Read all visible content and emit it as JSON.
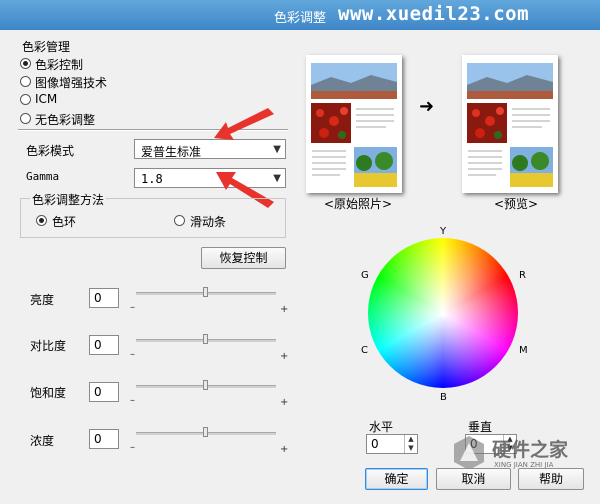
{
  "window": {
    "title": "色彩调整",
    "watermark": "www.xuedil23.com"
  },
  "color_mgmt": {
    "title": "色彩管理",
    "options": [
      {
        "label": "色彩控制",
        "selected": true
      },
      {
        "label": "图像增强技术",
        "selected": false
      },
      {
        "label": "ICM",
        "selected": false
      },
      {
        "label": "无色彩调整",
        "selected": false
      }
    ]
  },
  "color_mode": {
    "label": "色彩模式",
    "value": "爱普生标准"
  },
  "gamma": {
    "label": "Gamma",
    "value": "1.8"
  },
  "adjust_method": {
    "title": "色彩调整方法",
    "option1": "色环",
    "option2": "滑动条"
  },
  "restore_button": "恢复控制",
  "sliders": [
    {
      "label": "亮度",
      "value": "0"
    },
    {
      "label": "对比度",
      "value": "0"
    },
    {
      "label": "饱和度",
      "value": "0"
    },
    {
      "label": "浓度",
      "value": "0"
    }
  ],
  "slider_min": "–",
  "slider_max": "+",
  "preview": {
    "original_label": "<原始照片>",
    "preview_label": "<预览>",
    "arrow": "➜"
  },
  "wheel": {
    "top": "Y",
    "right_top": "R",
    "right_bottom": "M",
    "bottom": "B",
    "left_bottom": "C",
    "left_top": "G",
    "center": "+"
  },
  "horizontal": {
    "label": "水平",
    "value": "0"
  },
  "vertical": {
    "label": "垂直",
    "value": "0"
  },
  "buttons": {
    "ok": "确定",
    "cancel": "取消",
    "help": "帮助"
  },
  "logo": {
    "name": "硬件之家",
    "sub": "XING JIAN ZHI JIA"
  }
}
